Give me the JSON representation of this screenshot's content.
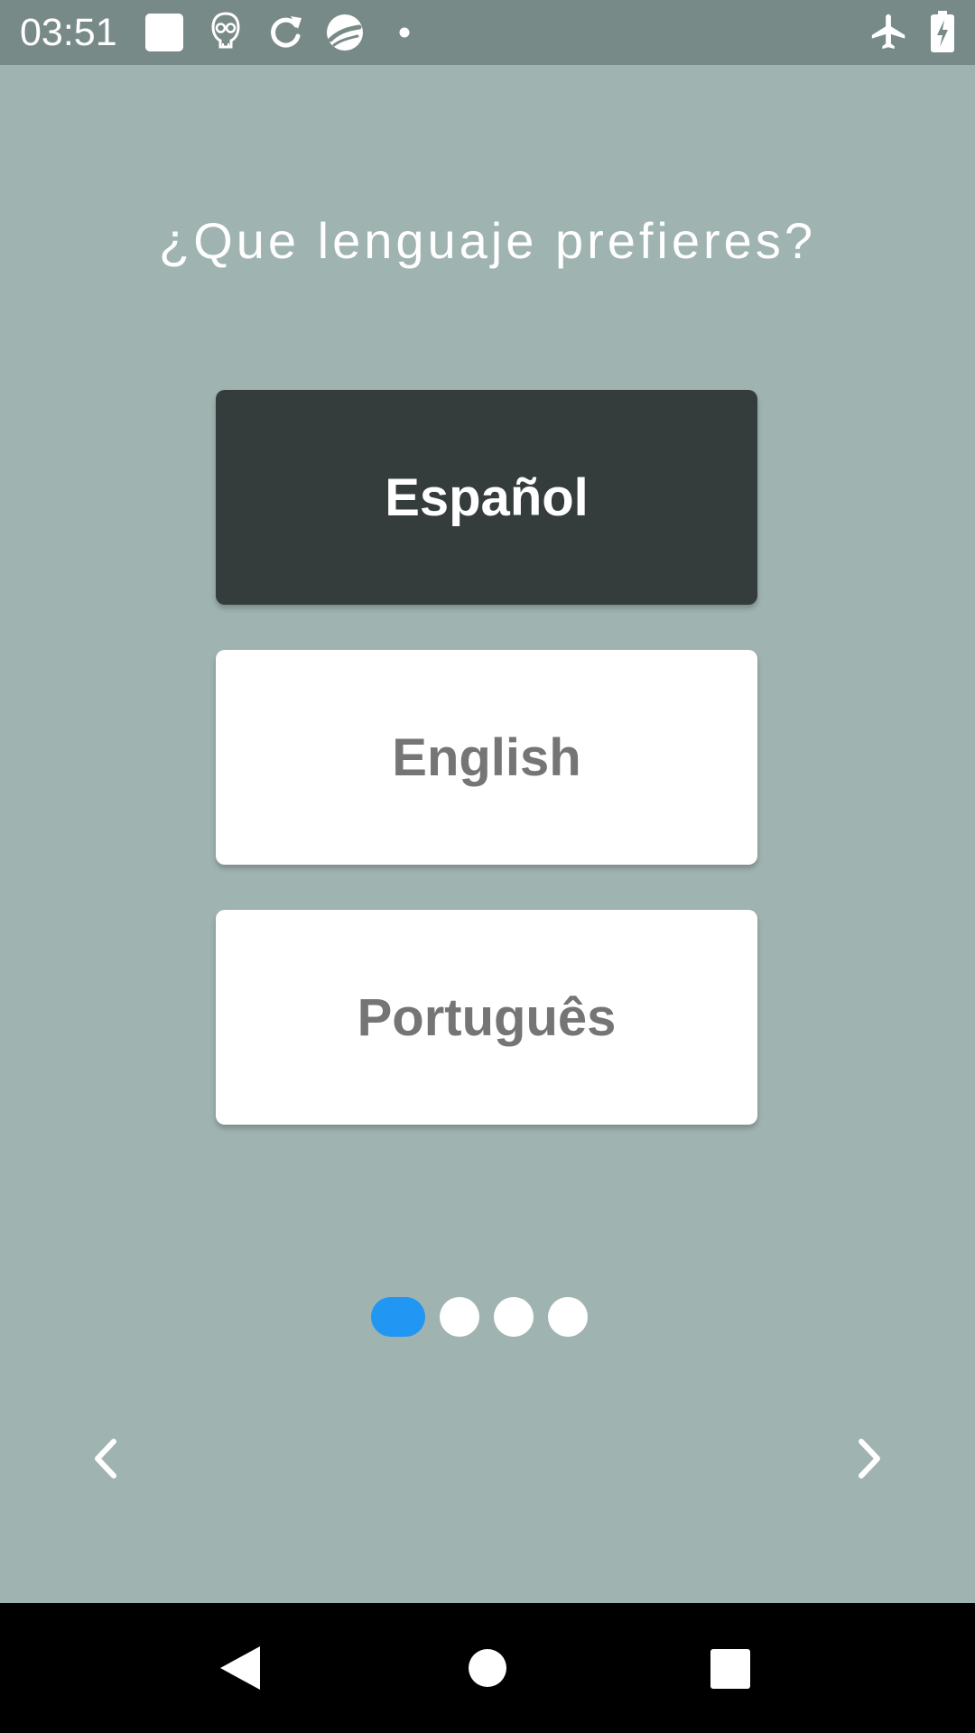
{
  "status_bar": {
    "time": "03:51",
    "icons": [
      "square-notification-icon",
      "robot-icon",
      "sync-icon",
      "swirl-app-icon",
      "dot-icon",
      "airplane-mode-icon",
      "battery-charging-icon"
    ]
  },
  "screen": {
    "title": "¿Que lenguaje prefieres?",
    "languages": [
      {
        "label": "Español",
        "selected": true
      },
      {
        "label": "English",
        "selected": false
      },
      {
        "label": "Português",
        "selected": false
      }
    ],
    "pager": {
      "total": 4,
      "current": 1
    },
    "nav": {
      "prev_icon": "chevron-left-icon",
      "next_icon": "chevron-right-icon"
    }
  },
  "system_nav": {
    "icons": [
      "back-icon",
      "home-icon",
      "recents-icon"
    ]
  },
  "colors": {
    "background": "#9fb3b0",
    "status_bar": "#788a87",
    "selected_button": "#353d3c",
    "unselected_button": "#ffffff",
    "unselected_text": "#757575",
    "active_dot": "#2196f3"
  }
}
